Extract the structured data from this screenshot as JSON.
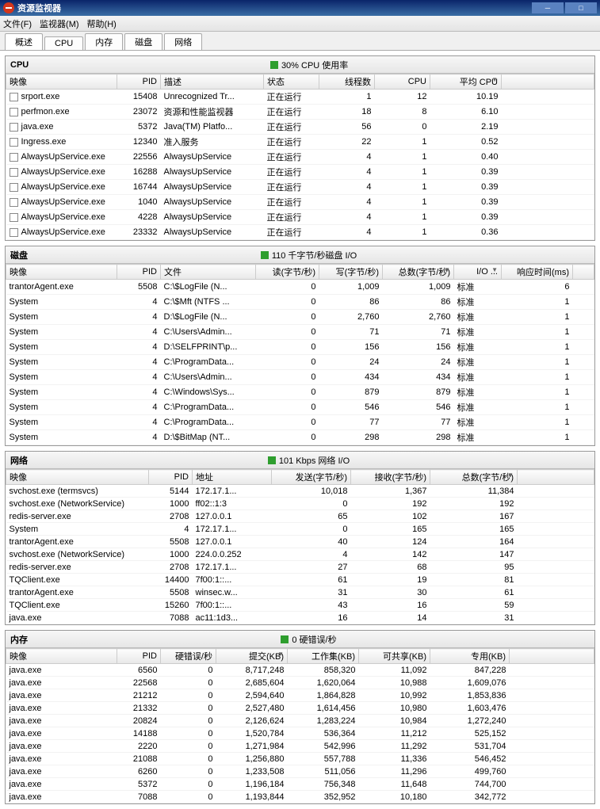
{
  "window": {
    "title": "资源监视器"
  },
  "menubar": {
    "file": "文件(F)",
    "monitor": "监视器(M)",
    "help": "帮助(H)"
  },
  "tabs": {
    "overview": "概述",
    "cpu": "CPU",
    "memory": "内存",
    "disk": "磁盘",
    "network": "网络"
  },
  "cpu": {
    "title": "CPU",
    "usage": "30% CPU 使用率",
    "cols": {
      "image": "映像",
      "pid": "PID",
      "desc": "描述",
      "status": "状态",
      "threads": "线程数",
      "cpu": "CPU",
      "avgcpu": "平均 CPU"
    },
    "status_running": "正在运行",
    "rows": [
      {
        "image": "srport.exe",
        "pid": "15408",
        "desc": "Unrecognized Tr...",
        "threads": "1",
        "cpu": "12",
        "avgcpu": "10.19"
      },
      {
        "image": "perfmon.exe",
        "pid": "23072",
        "desc": "资源和性能监视器",
        "threads": "18",
        "cpu": "8",
        "avgcpu": "6.10"
      },
      {
        "image": "java.exe",
        "pid": "5372",
        "desc": "Java(TM) Platfo...",
        "threads": "56",
        "cpu": "0",
        "avgcpu": "2.19"
      },
      {
        "image": "Ingress.exe",
        "pid": "12340",
        "desc": "准入服务",
        "threads": "22",
        "cpu": "1",
        "avgcpu": "0.52"
      },
      {
        "image": "AlwaysUpService.exe",
        "pid": "22556",
        "desc": "AlwaysUpService",
        "threads": "4",
        "cpu": "1",
        "avgcpu": "0.40"
      },
      {
        "image": "AlwaysUpService.exe",
        "pid": "16288",
        "desc": "AlwaysUpService",
        "threads": "4",
        "cpu": "1",
        "avgcpu": "0.39"
      },
      {
        "image": "AlwaysUpService.exe",
        "pid": "16744",
        "desc": "AlwaysUpService",
        "threads": "4",
        "cpu": "1",
        "avgcpu": "0.39"
      },
      {
        "image": "AlwaysUpService.exe",
        "pid": "1040",
        "desc": "AlwaysUpService",
        "threads": "4",
        "cpu": "1",
        "avgcpu": "0.39"
      },
      {
        "image": "AlwaysUpService.exe",
        "pid": "4228",
        "desc": "AlwaysUpService",
        "threads": "4",
        "cpu": "1",
        "avgcpu": "0.39"
      },
      {
        "image": "AlwaysUpService.exe",
        "pid": "23332",
        "desc": "AlwaysUpService",
        "threads": "4",
        "cpu": "1",
        "avgcpu": "0.36"
      }
    ]
  },
  "disk": {
    "title": "磁盘",
    "usage": "110 千字节/秒磁盘 I/O",
    "cols": {
      "image": "映像",
      "pid": "PID",
      "file": "文件",
      "read": "读(字节/秒)",
      "write": "写(字节/秒)",
      "total": "总数(字节/秒)",
      "io": "I/O ...",
      "resp": "响应时间(ms)"
    },
    "priority_normal": "标准",
    "rows": [
      {
        "image": "trantorAgent.exe",
        "pid": "5508",
        "file": "C:\\$LogFile (N...",
        "read": "0",
        "write": "1,009",
        "total": "1,009",
        "resp": "6"
      },
      {
        "image": "System",
        "pid": "4",
        "file": "C:\\$Mft (NTFS ...",
        "read": "0",
        "write": "86",
        "total": "86",
        "resp": "1"
      },
      {
        "image": "System",
        "pid": "4",
        "file": "D:\\$LogFile (N...",
        "read": "0",
        "write": "2,760",
        "total": "2,760",
        "resp": "1"
      },
      {
        "image": "System",
        "pid": "4",
        "file": "C:\\Users\\Admin...",
        "read": "0",
        "write": "71",
        "total": "71",
        "resp": "1"
      },
      {
        "image": "System",
        "pid": "4",
        "file": "D:\\SELFPRINT\\p...",
        "read": "0",
        "write": "156",
        "total": "156",
        "resp": "1"
      },
      {
        "image": "System",
        "pid": "4",
        "file": "C:\\ProgramData...",
        "read": "0",
        "write": "24",
        "total": "24",
        "resp": "1"
      },
      {
        "image": "System",
        "pid": "4",
        "file": "C:\\Users\\Admin...",
        "read": "0",
        "write": "434",
        "total": "434",
        "resp": "1"
      },
      {
        "image": "System",
        "pid": "4",
        "file": "C:\\Windows\\Sys...",
        "read": "0",
        "write": "879",
        "total": "879",
        "resp": "1"
      },
      {
        "image": "System",
        "pid": "4",
        "file": "C:\\ProgramData...",
        "read": "0",
        "write": "546",
        "total": "546",
        "resp": "1"
      },
      {
        "image": "System",
        "pid": "4",
        "file": "C:\\ProgramData...",
        "read": "0",
        "write": "77",
        "total": "77",
        "resp": "1"
      },
      {
        "image": "System",
        "pid": "4",
        "file": "D:\\$BitMap (NT...",
        "read": "0",
        "write": "298",
        "total": "298",
        "resp": "1"
      }
    ]
  },
  "network": {
    "title": "网络",
    "usage": "101 Kbps 网络 I/O",
    "cols": {
      "image": "映像",
      "pid": "PID",
      "addr": "地址",
      "send": "发送(字节/秒)",
      "recv": "接收(字节/秒)",
      "total": "总数(字节/秒)"
    },
    "rows": [
      {
        "image": "svchost.exe (termsvcs)",
        "pid": "5144",
        "addr": "172.17.1...",
        "send": "10,018",
        "recv": "1,367",
        "total": "11,384"
      },
      {
        "image": "svchost.exe (NetworkService)",
        "pid": "1000",
        "addr": "ff02::1:3",
        "send": "0",
        "recv": "192",
        "total": "192"
      },
      {
        "image": "redis-server.exe",
        "pid": "2708",
        "addr": "127.0.0.1",
        "send": "65",
        "recv": "102",
        "total": "167"
      },
      {
        "image": "System",
        "pid": "4",
        "addr": "172.17.1...",
        "send": "0",
        "recv": "165",
        "total": "165"
      },
      {
        "image": "trantorAgent.exe",
        "pid": "5508",
        "addr": "127.0.0.1",
        "send": "40",
        "recv": "124",
        "total": "164"
      },
      {
        "image": "svchost.exe (NetworkService)",
        "pid": "1000",
        "addr": "224.0.0.252",
        "send": "4",
        "recv": "142",
        "total": "147"
      },
      {
        "image": "redis-server.exe",
        "pid": "2708",
        "addr": "172.17.1...",
        "send": "27",
        "recv": "68",
        "total": "95"
      },
      {
        "image": "TQClient.exe",
        "pid": "14400",
        "addr": "7f00:1::...",
        "send": "61",
        "recv": "19",
        "total": "81"
      },
      {
        "image": "trantorAgent.exe",
        "pid": "5508",
        "addr": "winsec.w...",
        "send": "31",
        "recv": "30",
        "total": "61"
      },
      {
        "image": "TQClient.exe",
        "pid": "15260",
        "addr": "7f00:1::...",
        "send": "43",
        "recv": "16",
        "total": "59"
      },
      {
        "image": "java.exe",
        "pid": "7088",
        "addr": "ac11:1d3...",
        "send": "16",
        "recv": "14",
        "total": "31"
      }
    ]
  },
  "memory": {
    "title": "内存",
    "usage": "0 硬错误/秒",
    "cols": {
      "image": "映像",
      "pid": "PID",
      "faults": "硬错误/秒",
      "commit": "提交(KB)",
      "workset": "工作集(KB)",
      "shareable": "可共享(KB)",
      "private": "专用(KB)"
    },
    "rows": [
      {
        "image": "java.exe",
        "pid": "6560",
        "faults": "0",
        "commit": "8,717,248",
        "workset": "858,320",
        "shareable": "11,092",
        "private": "847,228"
      },
      {
        "image": "java.exe",
        "pid": "22568",
        "faults": "0",
        "commit": "2,685,604",
        "workset": "1,620,064",
        "shareable": "10,988",
        "private": "1,609,076"
      },
      {
        "image": "java.exe",
        "pid": "21212",
        "faults": "0",
        "commit": "2,594,640",
        "workset": "1,864,828",
        "shareable": "10,992",
        "private": "1,853,836"
      },
      {
        "image": "java.exe",
        "pid": "21332",
        "faults": "0",
        "commit": "2,527,480",
        "workset": "1,614,456",
        "shareable": "10,980",
        "private": "1,603,476"
      },
      {
        "image": "java.exe",
        "pid": "20824",
        "faults": "0",
        "commit": "2,126,624",
        "workset": "1,283,224",
        "shareable": "10,984",
        "private": "1,272,240"
      },
      {
        "image": "java.exe",
        "pid": "14188",
        "faults": "0",
        "commit": "1,520,784",
        "workset": "536,364",
        "shareable": "11,212",
        "private": "525,152"
      },
      {
        "image": "java.exe",
        "pid": "2220",
        "faults": "0",
        "commit": "1,271,984",
        "workset": "542,996",
        "shareable": "11,292",
        "private": "531,704"
      },
      {
        "image": "java.exe",
        "pid": "21088",
        "faults": "0",
        "commit": "1,256,880",
        "workset": "557,788",
        "shareable": "11,336",
        "private": "546,452"
      },
      {
        "image": "java.exe",
        "pid": "6260",
        "faults": "0",
        "commit": "1,233,508",
        "workset": "511,056",
        "shareable": "11,296",
        "private": "499,760"
      },
      {
        "image": "java.exe",
        "pid": "5372",
        "faults": "0",
        "commit": "1,196,184",
        "workset": "756,348",
        "shareable": "11,648",
        "private": "744,700"
      },
      {
        "image": "java.exe",
        "pid": "7088",
        "faults": "0",
        "commit": "1,193,844",
        "workset": "352,952",
        "shareable": "10,180",
        "private": "342,772"
      }
    ]
  }
}
